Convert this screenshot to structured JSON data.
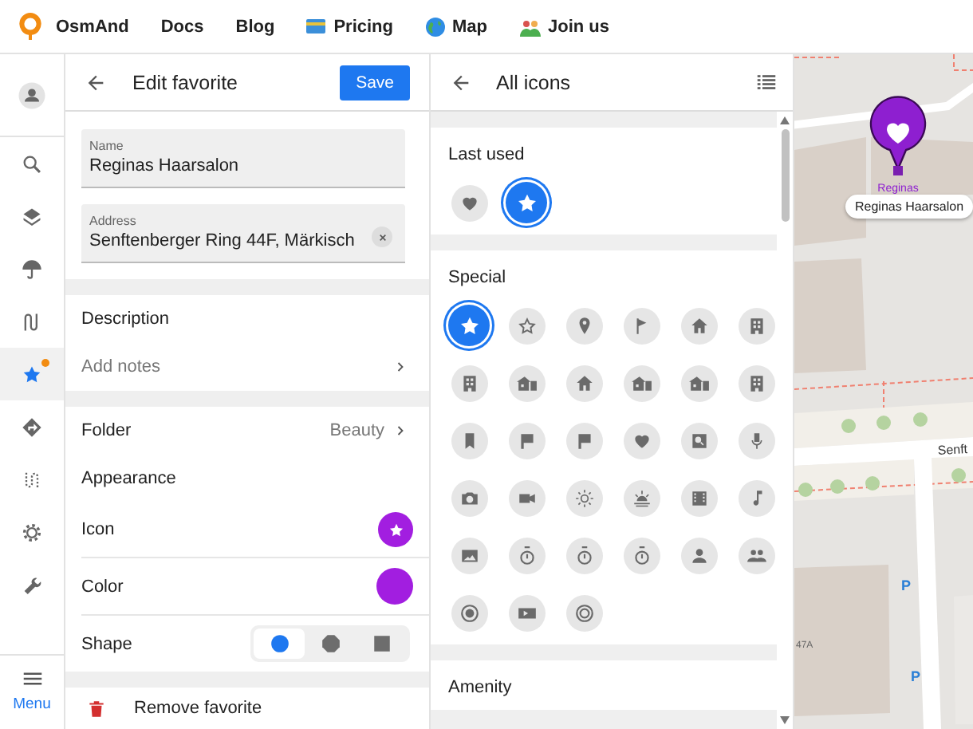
{
  "nav": {
    "logo": "OsmAnd",
    "links": [
      {
        "label": "Docs"
      },
      {
        "label": "Blog"
      },
      {
        "label": "Pricing"
      },
      {
        "label": "Map"
      },
      {
        "label": "Join us"
      }
    ]
  },
  "rail": {
    "items": [
      {
        "selected": false,
        "badge": false
      },
      {
        "selected": false,
        "badge": false
      },
      {
        "selected": false,
        "badge": false
      },
      {
        "selected": false,
        "badge": false
      },
      {
        "selected": false,
        "badge": false
      },
      {
        "selected": true,
        "badge": true
      },
      {
        "selected": false,
        "badge": false
      },
      {
        "selected": false,
        "badge": false
      },
      {
        "selected": false,
        "badge": false
      },
      {
        "selected": false,
        "badge": false
      }
    ],
    "menu": "Menu"
  },
  "edit": {
    "title": "Edit favorite",
    "save": "Save",
    "fields": [
      {
        "label": "Name",
        "value": "Reginas Haarsalon",
        "clearable": false
      },
      {
        "label": "Address",
        "value": "Senftenberger Ring 44F, Märkisch",
        "clearable": true
      }
    ],
    "description": {
      "title": "Description",
      "placeholder": "Add notes"
    },
    "folder": {
      "label": "Folder",
      "value": "Beauty"
    },
    "appearance": {
      "title": "Appearance",
      "icon_label": "Icon",
      "color_label": "Color",
      "color": "#a21ee0",
      "shape_label": "Shape",
      "shapes": [
        {
          "selected": true
        },
        {
          "selected": false
        },
        {
          "selected": false
        }
      ]
    },
    "remove": "Remove favorite"
  },
  "icons": {
    "title": "All icons",
    "sections": [
      {
        "title": "Last used",
        "icons": [
          {
            "selected": false
          },
          {
            "selected": true
          }
        ]
      },
      {
        "title": "Special",
        "icons": [
          {
            "selected": true
          },
          {
            "selected": false
          },
          {
            "selected": false
          },
          {
            "selected": false
          },
          {
            "selected": false
          },
          {
            "selected": false
          },
          {
            "selected": false
          },
          {
            "selected": false
          },
          {
            "selected": false
          },
          {
            "selected": false
          },
          {
            "selected": false
          },
          {
            "selected": false
          },
          {
            "selected": false
          },
          {
            "selected": false
          },
          {
            "selected": false
          },
          {
            "selected": false
          },
          {
            "selected": false
          },
          {
            "selected": false
          },
          {
            "selected": false
          },
          {
            "selected": false
          },
          {
            "selected": false
          },
          {
            "selected": false
          },
          {
            "selected": false
          },
          {
            "selected": false
          },
          {
            "selected": false
          },
          {
            "selected": false
          },
          {
            "selected": false
          },
          {
            "selected": false
          },
          {
            "selected": false
          },
          {
            "selected": false
          },
          {
            "selected": false
          },
          {
            "selected": false
          },
          {
            "selected": false
          }
        ]
      },
      {
        "title": "Amenity"
      }
    ]
  },
  "map": {
    "pin_label": "Reginas",
    "callout": "Reginas Haarsalon",
    "street": "Senft",
    "house_number": "47A",
    "parking": [
      "P",
      "P"
    ]
  }
}
